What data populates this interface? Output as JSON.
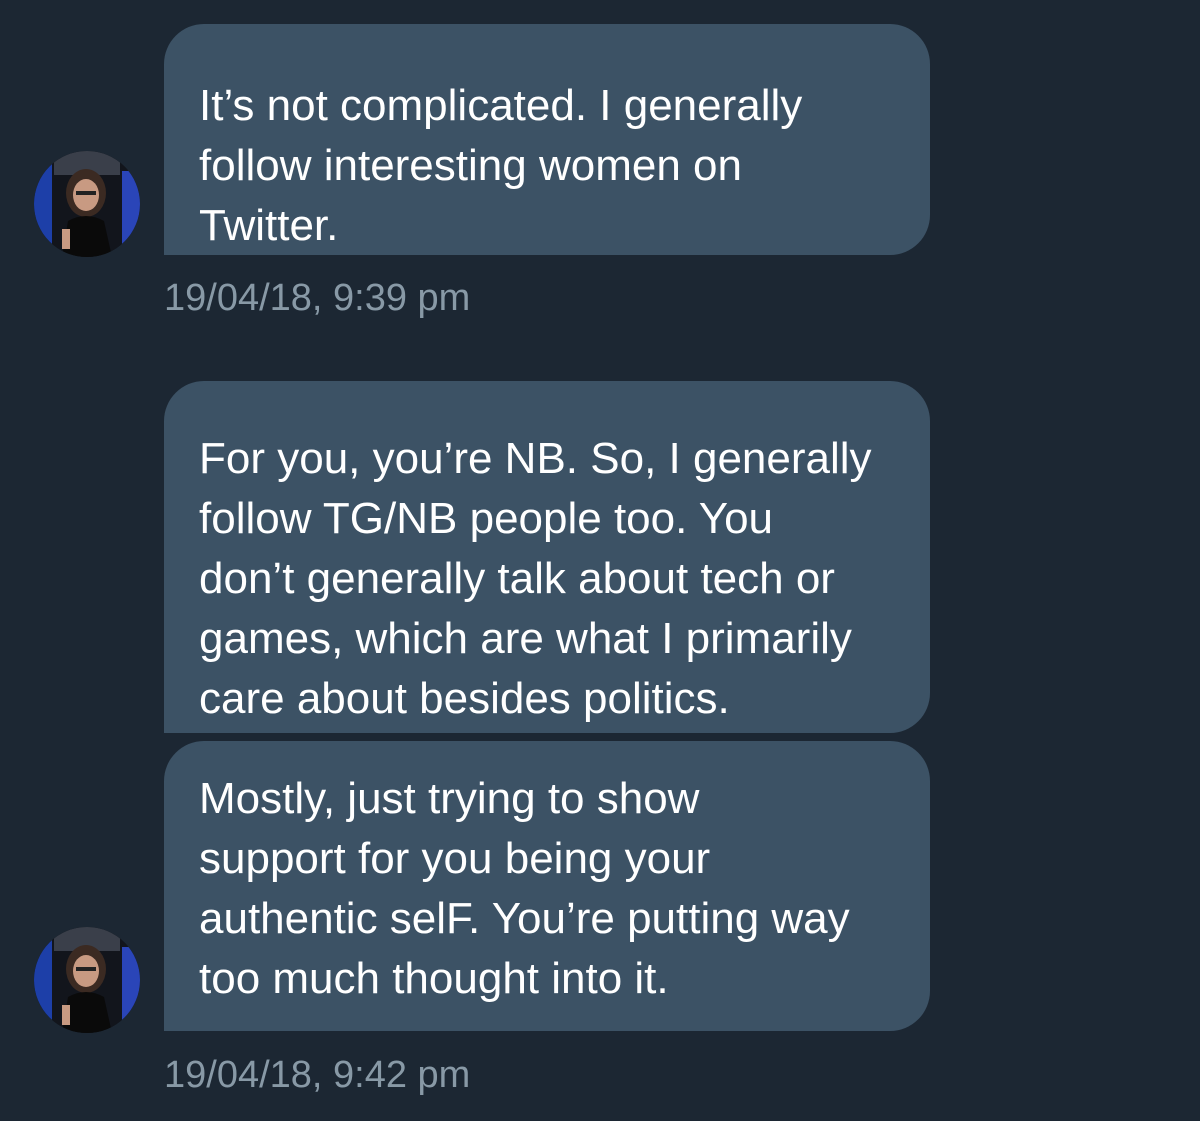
{
  "conversation": {
    "groups": [
      {
        "messages": [
          {
            "text": "It’s not complicated. I generally\nfollow interesting women on\nTwitter."
          }
        ],
        "timestamp": "19/04/18, 9:39 pm"
      },
      {
        "messages": [
          {
            "text": "For you, you’re NB. So, I generally\nfollow TG/NB people too. You\ndon’t generally talk about tech or\ngames, which are what I primarily\ncare about besides politics."
          },
          {
            "text": "Mostly, just trying to show\nsupport for you being your\nauthentic selF. You’re putting way\ntoo much thought into it."
          }
        ],
        "timestamp": "19/04/18, 9:42 pm"
      }
    ]
  },
  "colors": {
    "background": "#1c2733",
    "bubble": "#3c5265",
    "message_text": "#ffffff",
    "timestamp_text": "#8899a6"
  }
}
